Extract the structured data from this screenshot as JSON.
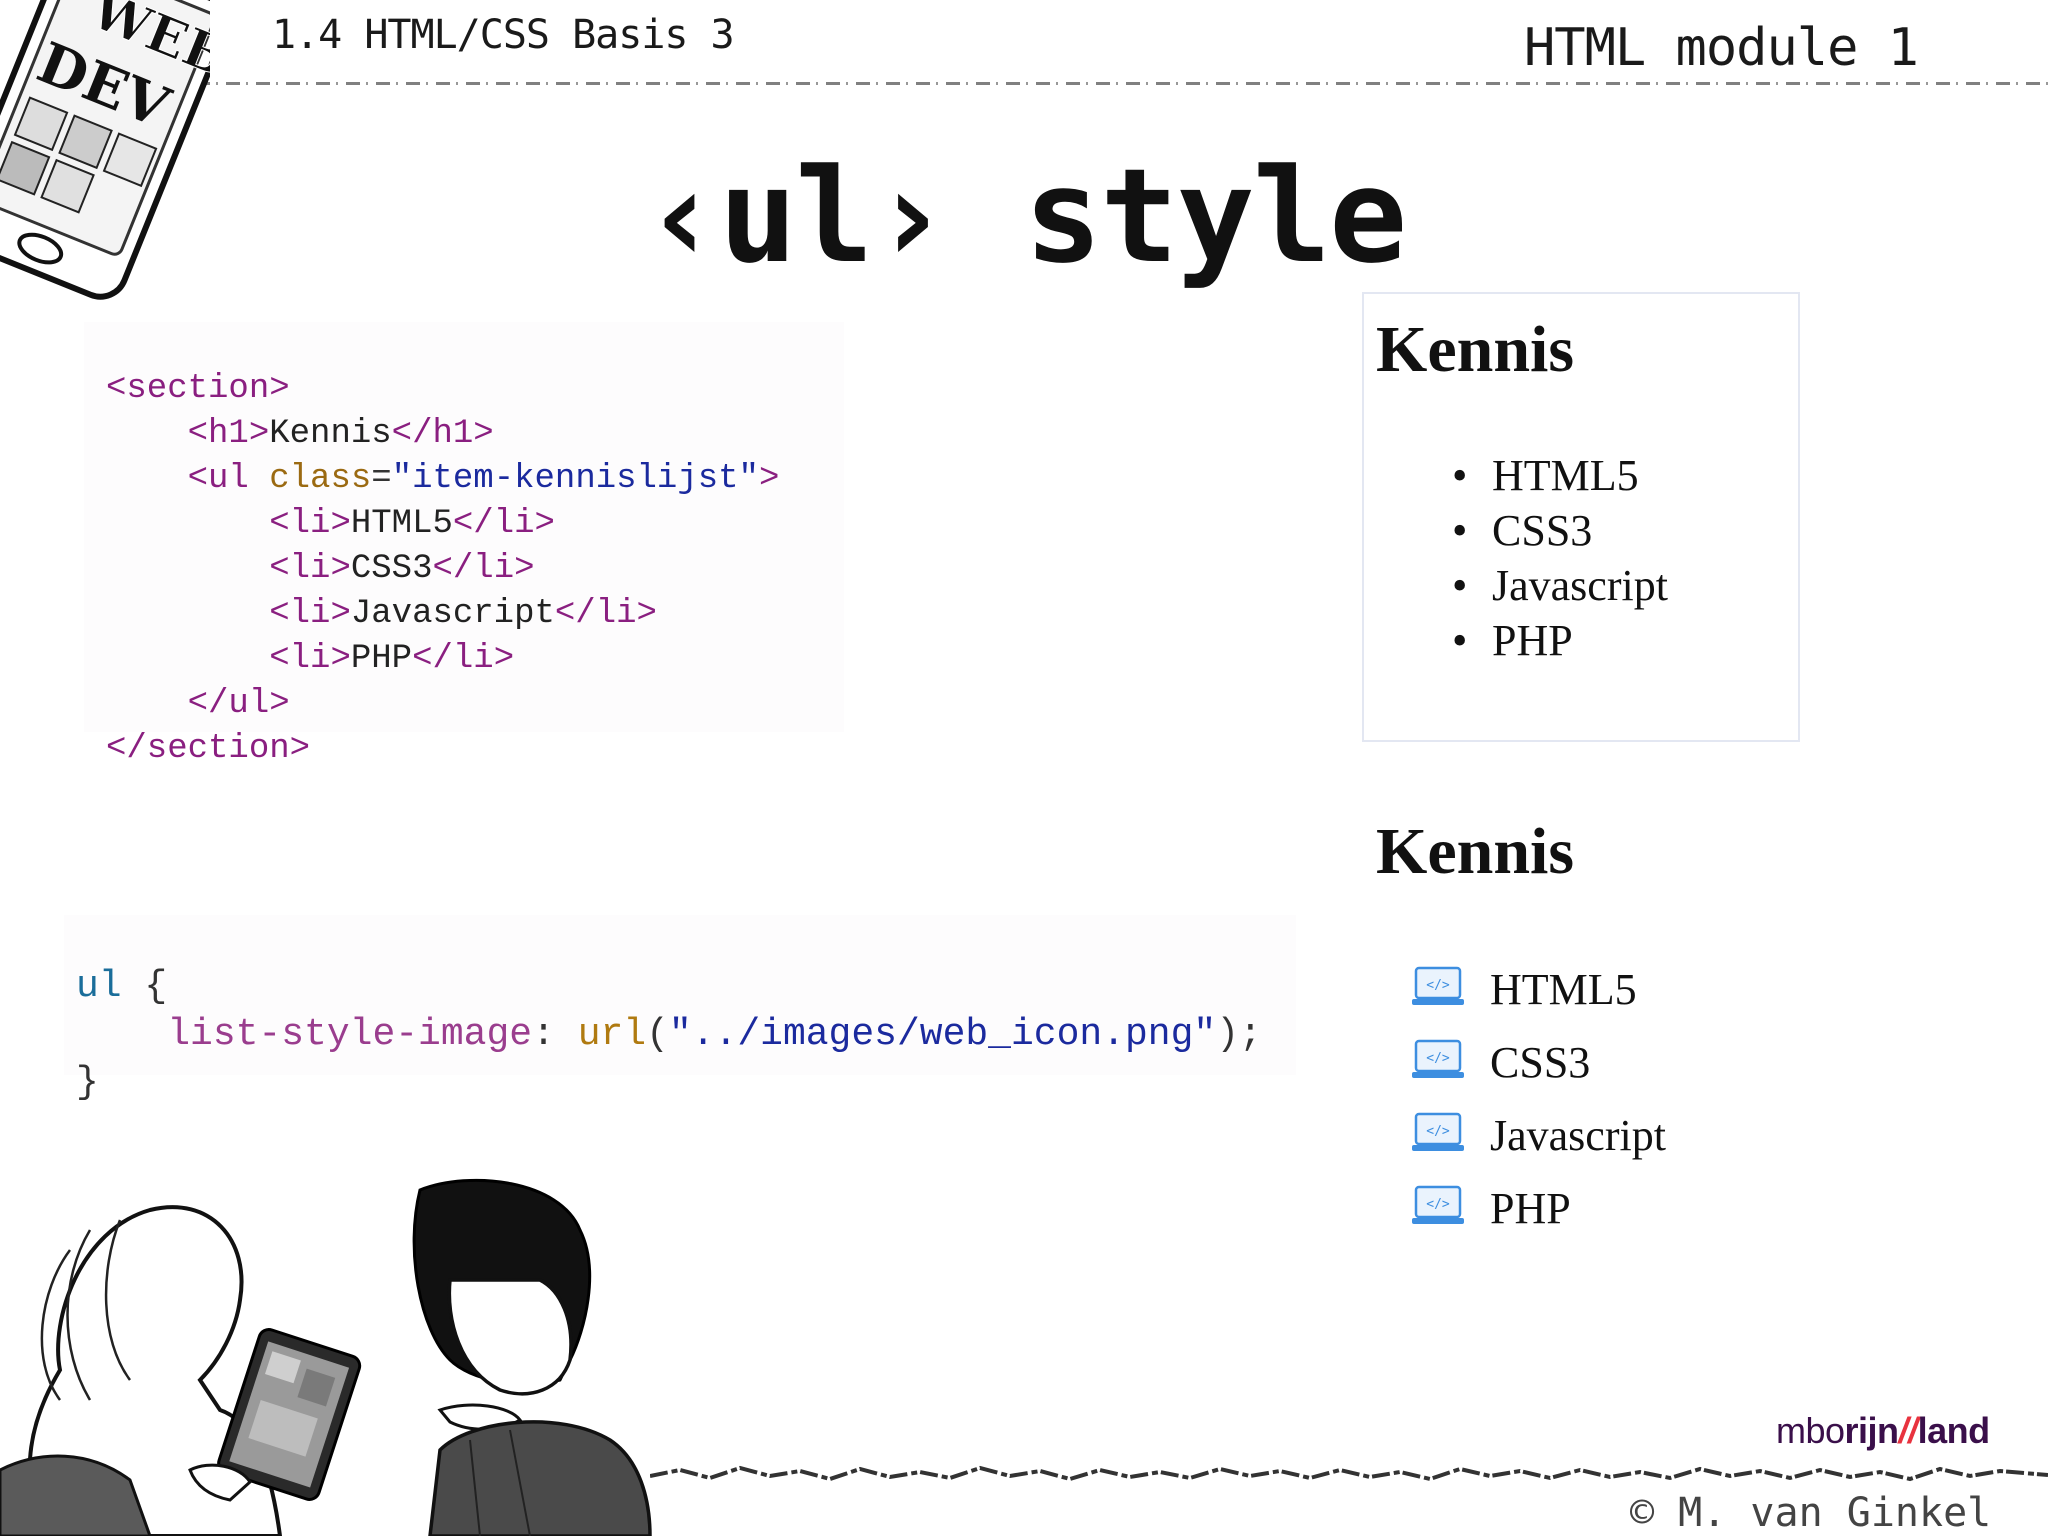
{
  "header": {
    "left": "1.4 HTML/CSS Basis 3",
    "right": "HTML module 1"
  },
  "title": "‹ul› style",
  "html_code": {
    "lines": [
      {
        "t1": "<section>"
      },
      {
        "t1": "<h1>",
        "t2": "Kennis",
        "t3": "</h1>"
      },
      {
        "t1": "<ul ",
        "t2": "class",
        "t3": "=",
        "t4": "\"item-kennislijst\"",
        "t5": ">"
      },
      {
        "t1": "<li>",
        "t2": "HTML5",
        "t3": "</li>"
      },
      {
        "t1": "<li>",
        "t2": "CSS3",
        "t3": "</li>"
      },
      {
        "t1": "<li>",
        "t2": "Javascript",
        "t3": "</li>"
      },
      {
        "t1": "<li>",
        "t2": "PHP",
        "t3": "</li>"
      },
      {
        "t1": "</ul>"
      },
      {
        "t1": "</section>"
      }
    ]
  },
  "css_code": {
    "selector": "ul",
    "open": " {",
    "property": "list-style-image",
    "colon": ": ",
    "fn": "url",
    "open_paren": "(",
    "value": "\"../images/web_icon.png\"",
    "close_paren": ");",
    "close": "}"
  },
  "preview_1": {
    "heading": "Kennis",
    "bullet": "•",
    "items": [
      "HTML5",
      "CSS3",
      "Javascript",
      "PHP"
    ]
  },
  "preview_2": {
    "heading": "Kennis",
    "items": [
      "HTML5",
      "CSS3",
      "Javascript",
      "PHP"
    ],
    "icon": "web-icon"
  },
  "phone_illustration": {
    "screen_text_1": "WEB",
    "screen_text_2": "DEV"
  },
  "brand": {
    "part1": "mbo",
    "part2": "rijn",
    "part3": "//",
    "part4": "land"
  },
  "copyright": "© M. van Ginkel"
}
